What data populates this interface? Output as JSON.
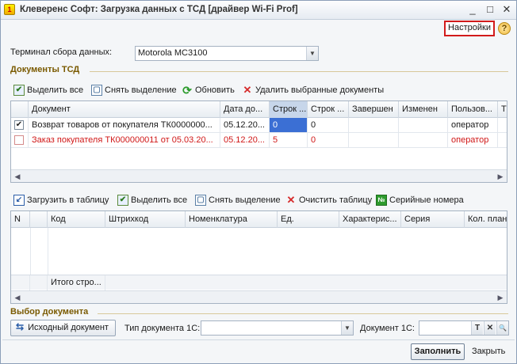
{
  "window": {
    "title": "Клеверенс Софт: Загрузка данных с ТСД [драйвер Wi-Fi Prof]",
    "minimize_glyph": "_",
    "maximize_glyph": "□",
    "close_glyph": "✕",
    "settings_label": "Настройки",
    "help_glyph": "?",
    "app_icon_glyph": "1"
  },
  "terminal": {
    "label": "Терминал сбора данных:",
    "value": "Motorola MC3100",
    "arrow_glyph": "▼"
  },
  "docs_section": {
    "title": "Документы ТСД",
    "toolbar": {
      "select_all": "Выделить все",
      "deselect": "Снять выделение",
      "refresh": "Обновить",
      "delete_selected": "Удалить выбранные документы"
    },
    "columns": [
      "Документ",
      "Дата до...",
      "Строк ...",
      "Строк ...",
      "Завершен",
      "Изменен",
      "Пользов...",
      "Т"
    ],
    "rows": [
      {
        "checked": true,
        "document": "Возврат товаров от покупателя ТК0000000...",
        "date": "05.12.20...",
        "lines1": "0",
        "lines2": "0",
        "done": "",
        "changed": "",
        "user": "оператор",
        "red": false
      },
      {
        "checked": false,
        "document": "Заказ покупателя ТК000000011 от 05.03.20...",
        "date": "05.12.20...",
        "lines1": "5",
        "lines2": "0",
        "done": "",
        "changed": "",
        "user": "оператор",
        "red": true
      }
    ],
    "check_glyph": "✔"
  },
  "table_section": {
    "toolbar": {
      "load": "Загрузить в таблицу",
      "select_all": "Выделить все",
      "deselect": "Снять выделение",
      "clear": "Очистить таблицу",
      "serial": "Серийные номера"
    },
    "columns": [
      "N",
      "",
      "Код",
      "Штрихкод",
      "Номенклатура",
      "Ед.",
      "Характерис...",
      "Серия",
      "Кол. план"
    ],
    "footer_total": "Итого стро..."
  },
  "doc_select": {
    "title": "Выбор документа",
    "source_doc_button": "Исходный документ",
    "doc_type_label": "Тип документа 1С:",
    "doc_type_value": "",
    "doc_label": "Документ 1С:",
    "doc_value": "",
    "t_glyph": "T",
    "x_glyph": "✕",
    "search_glyph": "🔍"
  },
  "footer": {
    "fill_button": "Заполнить",
    "close_button": "Закрыть"
  },
  "icons": {
    "select_all": "✔",
    "deselect": "▢",
    "refresh": "⟳",
    "delete": "✕",
    "upload": "↙",
    "serial": "№",
    "scroll_left": "◀",
    "scroll_right": "▶",
    "source_doc": "⇆"
  },
  "colors": {
    "section_title": "#7a5a00",
    "red_row": "#d01818",
    "selected_cell": "#3b6fd4",
    "settings_border": "#d21b1b"
  }
}
